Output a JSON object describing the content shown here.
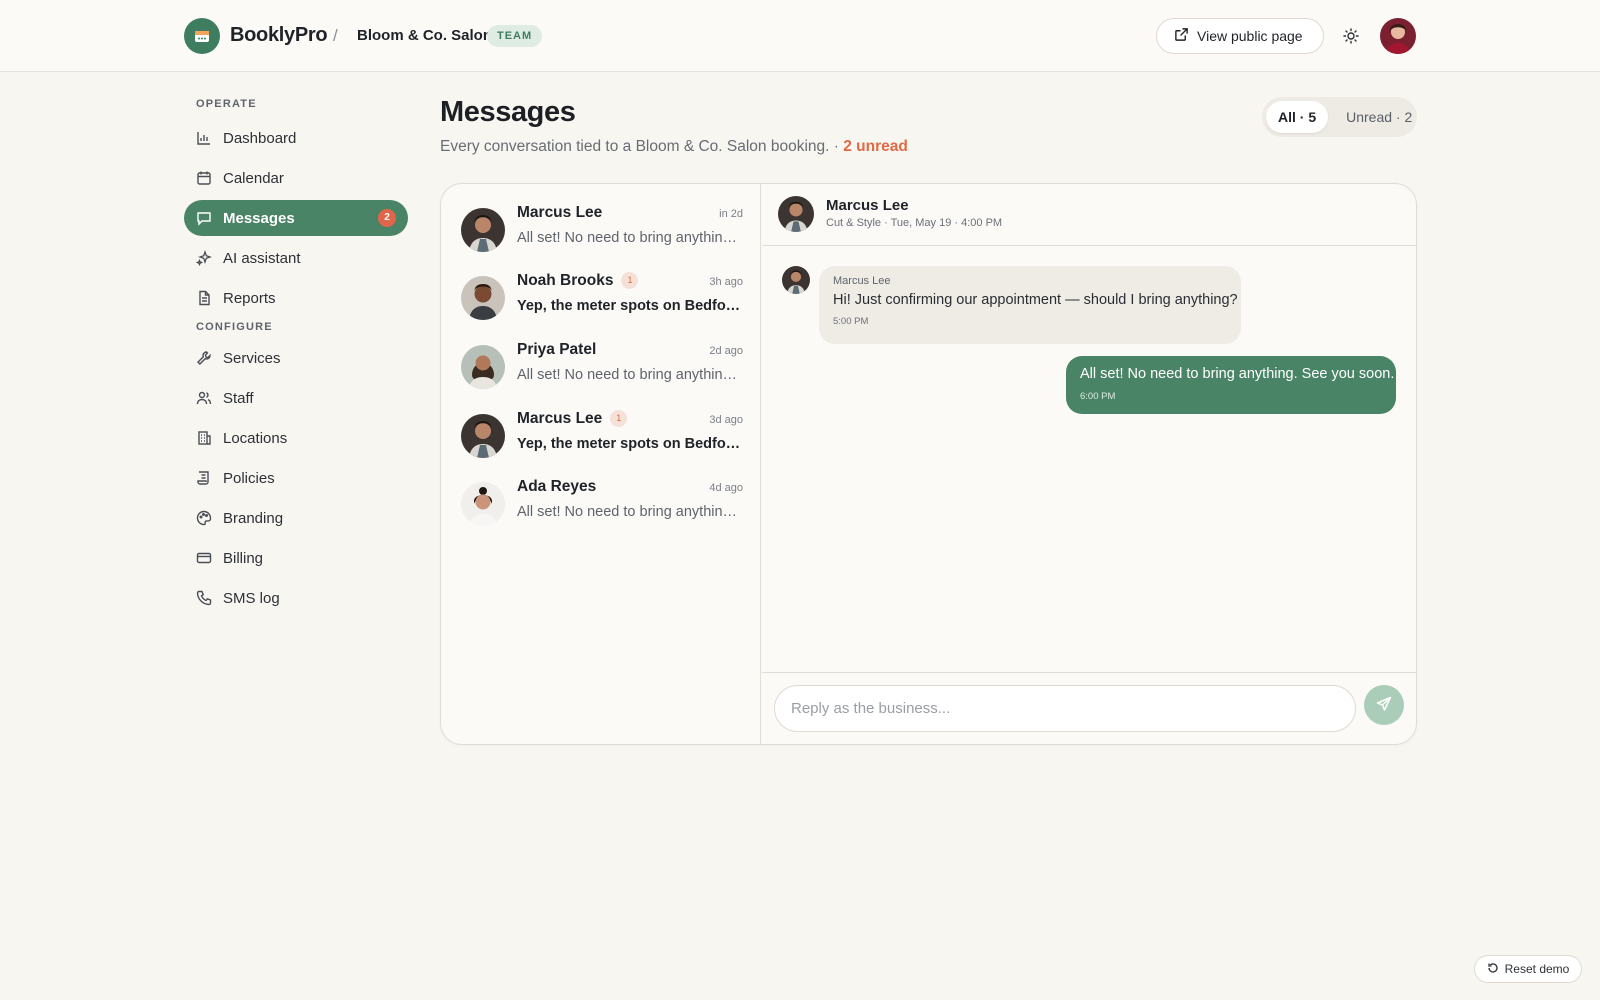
{
  "header": {
    "brand": "BooklyPro",
    "separator": "/",
    "org_name": "Bloom & Co. Salon",
    "org_badge": "TEAM",
    "view_public_label": "View public page"
  },
  "sidebar": {
    "sections": [
      {
        "title": "OPERATE"
      },
      {
        "title": "CONFIGURE"
      }
    ],
    "items": [
      {
        "label": "Dashboard",
        "icon": "bar-chart-icon"
      },
      {
        "label": "Calendar",
        "icon": "calendar-icon"
      },
      {
        "label": "Messages",
        "icon": "chat-bubble-icon",
        "count": "2",
        "active": true
      },
      {
        "label": "AI assistant",
        "icon": "sparkles-icon"
      },
      {
        "label": "Reports",
        "icon": "document-icon"
      },
      {
        "label": "Services",
        "icon": "wrench-icon"
      },
      {
        "label": "Staff",
        "icon": "users-icon"
      },
      {
        "label": "Locations",
        "icon": "building-icon"
      },
      {
        "label": "Policies",
        "icon": "scroll-icon"
      },
      {
        "label": "Branding",
        "icon": "palette-icon"
      },
      {
        "label": "Billing",
        "icon": "credit-card-icon"
      },
      {
        "label": "SMS log",
        "icon": "phone-icon"
      }
    ]
  },
  "page": {
    "title": "Messages",
    "subtitle": "Every conversation tied to a Bloom & Co. Salon booking. ·",
    "unread_text": "2 unread"
  },
  "filters": {
    "all": "All · 5",
    "unread": "Unread · 2"
  },
  "conversations": [
    {
      "name": "Marcus Lee",
      "time": "in 2d",
      "preview": "All set! No need to bring anything. See you soon.",
      "unread": "",
      "is_unread": false
    },
    {
      "name": "Noah Brooks",
      "time": "3h ago",
      "preview": "Yep, the meter spots on Bedford Ave are your best bet.",
      "unread": "1",
      "is_unread": true
    },
    {
      "name": "Priya Patel",
      "time": "2d ago",
      "preview": "All set! No need to bring anything. See you soon.",
      "unread": "",
      "is_unread": false
    },
    {
      "name": "Marcus Lee",
      "time": "3d ago",
      "preview": "Yep, the meter spots on Bedford Ave are your best bet.",
      "unread": "1",
      "is_unread": true
    },
    {
      "name": "Ada Reyes",
      "time": "4d ago",
      "preview": "All set! No need to bring anything. See you soon.",
      "unread": "",
      "is_unread": false
    }
  ],
  "thread": {
    "name": "Marcus Lee",
    "meta": "Cut & Style · Tue, May 19 · 4:00 PM",
    "messages": [
      {
        "sender": "Marcus Lee",
        "text": "Hi! Just confirming our appointment — should I bring anything?",
        "time": "5:00 PM",
        "direction": "in"
      },
      {
        "text": "All set! No need to bring anything. See you soon.",
        "time": "6:00 PM",
        "direction": "out"
      }
    ],
    "reply_placeholder": "Reply as the business..."
  },
  "reset_label": "Reset demo",
  "colors": {
    "accent": "#4a8467",
    "unread": "#df6b44",
    "background": "#f8f6f1"
  }
}
